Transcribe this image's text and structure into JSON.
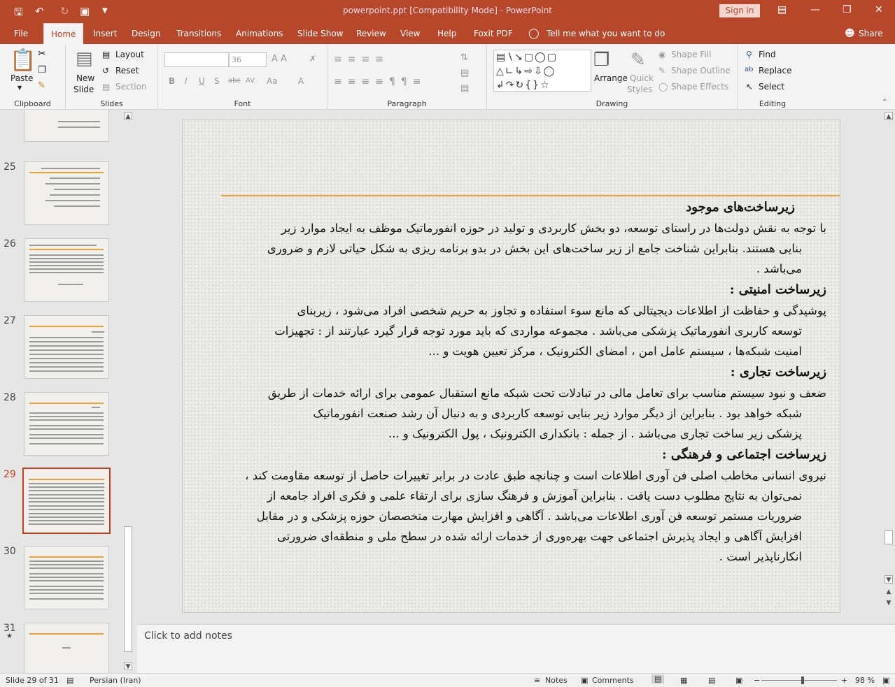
{
  "window": {
    "title": "powerpoint.ppt [Compatibility Mode]  -  PowerPoint",
    "signin": "Sign in"
  },
  "tabs": [
    {
      "label": "File"
    },
    {
      "label": "Home"
    },
    {
      "label": "Insert"
    },
    {
      "label": "Design"
    },
    {
      "label": "Transitions"
    },
    {
      "label": "Animations"
    },
    {
      "label": "Slide Show"
    },
    {
      "label": "Review"
    },
    {
      "label": "View"
    },
    {
      "label": "Help"
    },
    {
      "label": "Foxit PDF"
    },
    {
      "label": "Tell me what you want to do"
    }
  ],
  "share": "Share",
  "ribbon": {
    "clipboard": {
      "label": "Clipboard",
      "paste": "Paste"
    },
    "slides": {
      "label": "Slides",
      "new_slide": "New",
      "new_slide2": "Slide",
      "layout": "Layout",
      "reset": "Reset",
      "section": "Section"
    },
    "font": {
      "label": "Font",
      "size": "36"
    },
    "paragraph": {
      "label": "Paragraph"
    },
    "drawing": {
      "label": "Drawing",
      "arrange": "Arrange",
      "quick": "Quick",
      "styles": "Styles",
      "shape_fill": "Shape Fill",
      "shape_outline": "Shape Outline",
      "shape_effects": "Shape Effects"
    },
    "editing": {
      "label": "Editing",
      "find": "Find",
      "replace": "Replace",
      "select": "Select"
    }
  },
  "thumbnails": [
    {
      "num": "25",
      "selected": false
    },
    {
      "num": "26",
      "selected": false
    },
    {
      "num": "27",
      "selected": false
    },
    {
      "num": "28",
      "selected": false
    },
    {
      "num": "29",
      "selected": true
    },
    {
      "num": "30",
      "selected": false
    },
    {
      "num": "31",
      "selected": false,
      "star": "★"
    }
  ],
  "slide": {
    "h1": "زیرساخت‌های موجود",
    "p1a": "با توجه به نقش دولت‌ها در راستای توسعه، دو بخش کاربردی و تولید در حوزه انفورماتیک موظف به ایجاد موارد زیر",
    "p1b": "بنایی هستند. بنابراین شناخت جامع از زیر ساخت‌های این بخش در بدو برنامه ریزی به شکل حیاتی لازم و ضروری",
    "p1c": "می‌باشد .",
    "h2": "زیرساخت امنیتی :",
    "p2a": "پوشیدگی و حفاظت از اطلاعات دیجیتالی که مانع سوء استفاده و تجاوز به حریم شخصی افراد می‌شود ، زیربنای",
    "p2b": "توسعه کاربری انفورماتیک پزشکی می‌باشد . مجموعه مواردی که باید مورد توجه قرار گیرد عبارتند از : تجهیزات",
    "p2c": "امنیت شبکه‌ها ، سیستم عامل امن ، امضای الکترونیک ، مرکز تعیین هویت و ...",
    "h3": "زیرساخت تجاری :",
    "p3a": "ضعف و نبود سیستم مناسب برای تعامل مالی در تبادلات تحت شبکه مانع استقبال عمومی برای ارائه خدمات از طریق",
    "p3b": "شبکه خواهد بود . بنابراین از دیگر موارد زیر بنایی توسعه کاربردی و به دنبال آن رشد صنعت انفورماتیک",
    "p3c": "پزشکی زیر ساخت تجاری می‌باشد . از جمله : بانکداری الکترونیک ، پول الکترونیک و ...",
    "h4": "زیرساخت اجتماعی و فرهنگی :",
    "p4a": "نیروی انسانی مخاطب اصلی فن آوری اطلاعات است و چنانچه طبق عادت در برابر تغییرات حاصل از توسعه مقاومت کند ،",
    "p4b": "نمی‌توان به نتایج مطلوب دست یافت . بنابراین آموزش و فرهنگ سازی برای ارتقاء علمی و فکری افراد جامعه از",
    "p4c": "ضروریات مستمر توسعه فن آوری اطلاعات می‌باشد . آگاهی و افزایش مهارت متخصصان حوزه پزشکی و در مقابل",
    "p4d": "افزایش آگاهی و ایجاد پذیرش اجتماعی جهت بهره‌وری از خدمات ارائه شده در سطح ملی و منطقه‌ای ضرورتی",
    "p4e": "انکارناپذیر است ."
  },
  "notes_placeholder": "Click to add notes",
  "status": {
    "slide": "Slide 29 of 31",
    "language": "Persian (Iran)",
    "notes": "Notes",
    "comments": "Comments",
    "zoom": "98 %"
  }
}
